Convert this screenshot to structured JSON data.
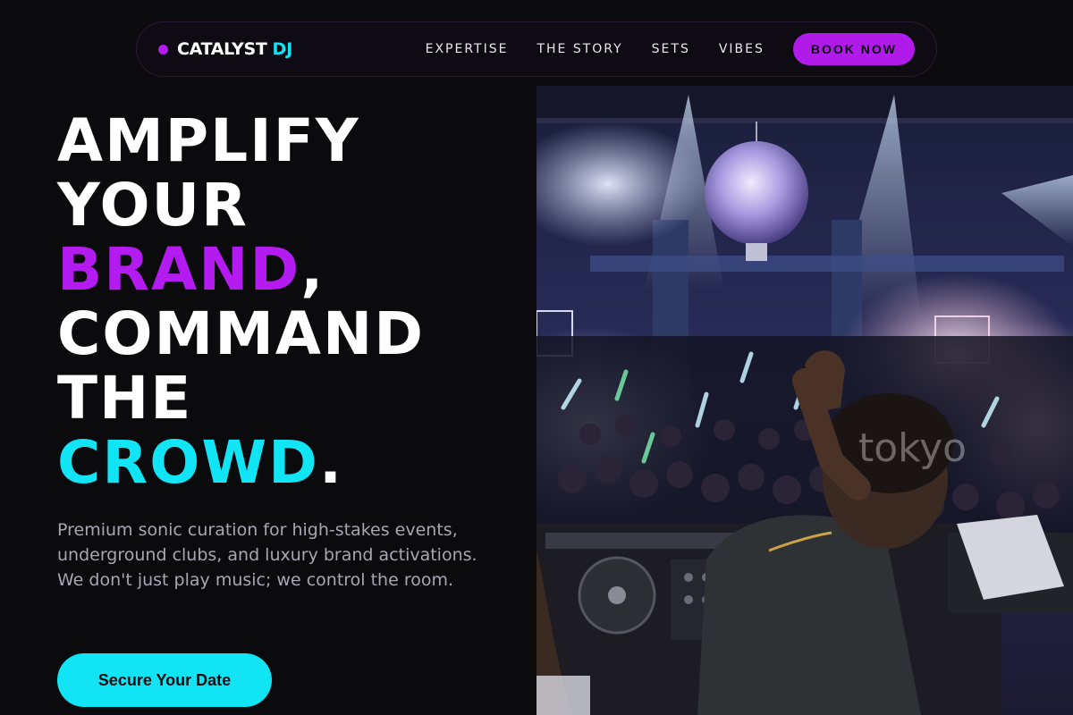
{
  "brand": {
    "name": "CATALYST",
    "accent": "DJ"
  },
  "nav": {
    "links": [
      "EXPERTISE",
      "THE STORY",
      "SETS",
      "VIBES"
    ],
    "cta_label": "BOOK NOW"
  },
  "hero": {
    "headline": {
      "line1": "AMPLIFY",
      "line2": "YOUR",
      "line3_accent": "BRAND",
      "line3_rest": ",",
      "line4": "COMMAND",
      "line5": "THE",
      "line6_accent": "CROWD",
      "line6_rest": "."
    },
    "lead": "Premium sonic curation for high-stakes events, underground clubs, and luxury brand activations. We don't just play music; we control the room.",
    "cta_label": "Secure Your Date",
    "image_alt": "DJ performing for a packed nightclub crowd under a disco ball",
    "image_watermark": "tokyo"
  },
  "colors": {
    "background": "#0b0a0d",
    "accent_purple": "#b31bf0",
    "accent_cyan": "#11e4f5",
    "muted_text": "#a9a6b3"
  },
  "icons": {
    "brand_dot": "dot-icon"
  }
}
